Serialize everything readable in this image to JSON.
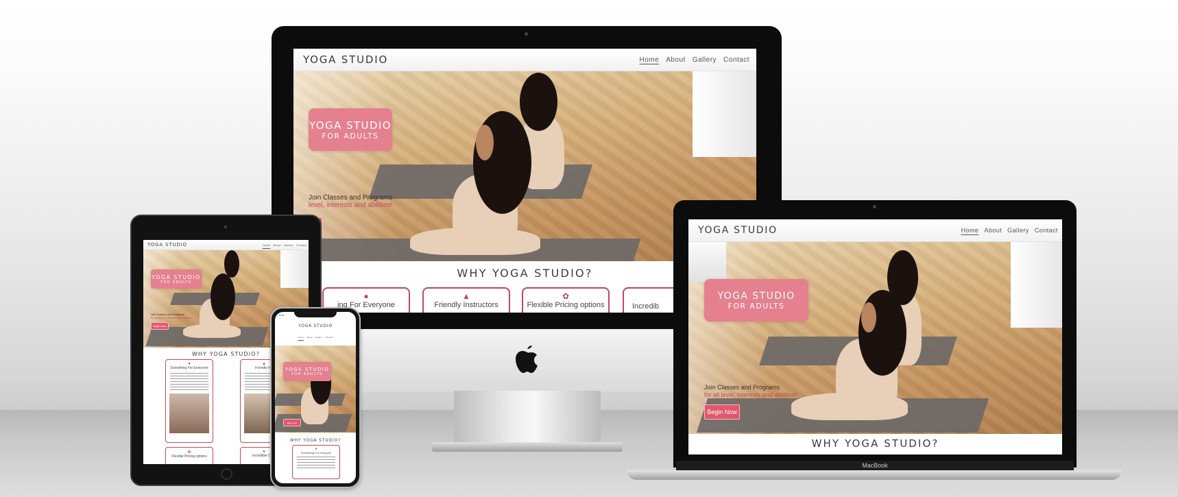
{
  "site": {
    "logo": "YOGA STUDIO",
    "nav": [
      "Home",
      "About",
      "Gallery",
      "Contact"
    ],
    "hero_title": "YOGA STUDIO",
    "hero_subtitle": "FOR ADULTS",
    "tagline": "Join Classes and Programs",
    "tagline_sub": "for all level, interests and abilities!",
    "tagline_sub_cropped": "level, interests and abilities!",
    "cta": "Begin Now",
    "why_title": "WHY YOGA STUDIO?",
    "features": [
      "Something For Everyone",
      "Friendly Instructors",
      "Flexible Pricing options",
      "Incredible Community"
    ],
    "features_cropped": {
      "imac_first": "ing For Everyone",
      "imac_last": "Incredib",
      "ipad_second": "Friendly Ins",
      "ipad_fourth": "Incredible Com"
    }
  },
  "devices": {
    "laptop_label": "MacBook",
    "phone_status_time": "9:41"
  },
  "colors": {
    "accent": "#e5808e",
    "button": "#e3566c",
    "card_border": "#c2475c"
  }
}
